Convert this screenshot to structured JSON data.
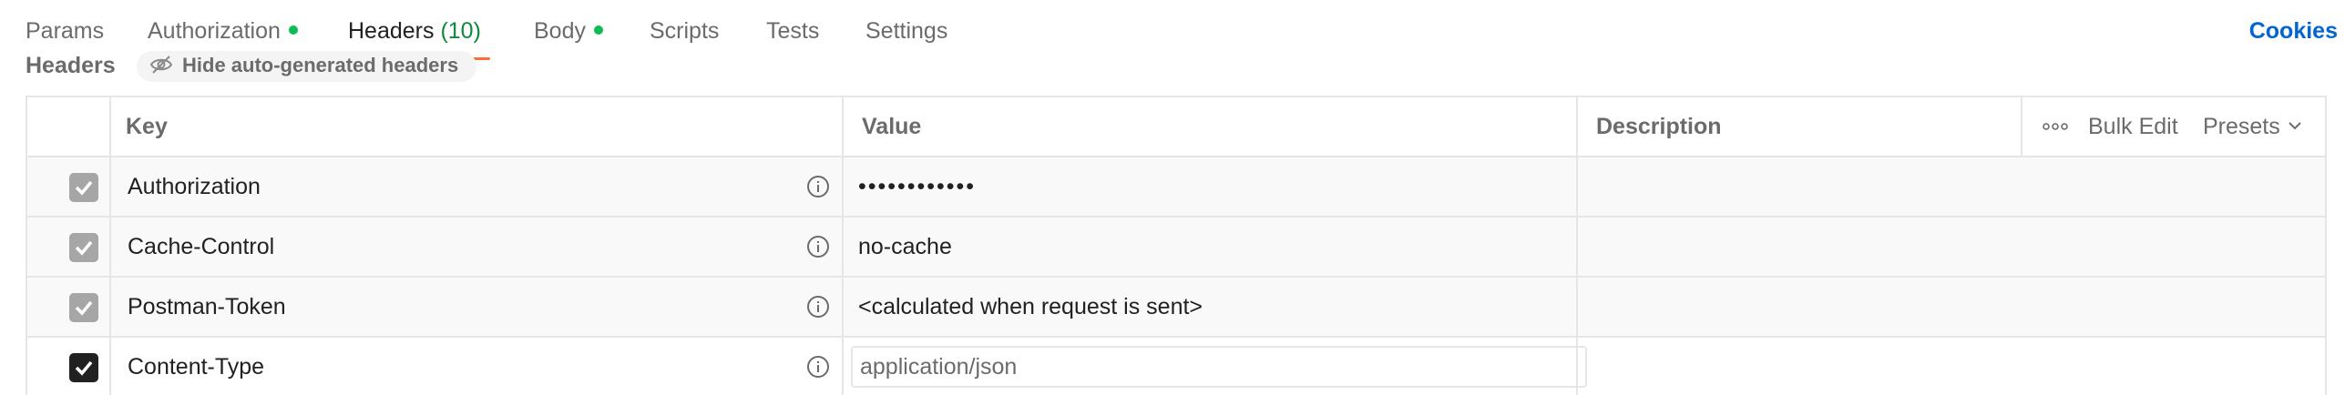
{
  "tabs": [
    {
      "label": "Params",
      "dot": false
    },
    {
      "label": "Authorization",
      "dot": true
    },
    {
      "label": "Headers",
      "count": "(10)",
      "active": true
    },
    {
      "label": "Body",
      "dot": true
    },
    {
      "label": "Scripts"
    },
    {
      "label": "Tests"
    },
    {
      "label": "Settings"
    }
  ],
  "cookies_label": "Cookies",
  "section": {
    "title": "Headers",
    "hide_label": "Hide auto-generated headers"
  },
  "table": {
    "columns": {
      "key": "Key",
      "value": "Value",
      "description": "Description"
    },
    "bulk_edit_label": "Bulk Edit",
    "presets_label": "Presets",
    "rows": [
      {
        "key": "Authorization",
        "value": "••••••••••••",
        "checked": true,
        "editable": false
      },
      {
        "key": "Cache-Control",
        "value": "no-cache",
        "checked": true,
        "editable": false
      },
      {
        "key": "Postman-Token",
        "value": "<calculated when request is sent>",
        "checked": true,
        "editable": false
      },
      {
        "key": "Content-Type",
        "value": "application/json",
        "checked": true,
        "editable": true
      }
    ]
  },
  "colors": {
    "accent": "#ff6c37",
    "status_dot": "#0cbb52",
    "link": "#0265d2"
  }
}
